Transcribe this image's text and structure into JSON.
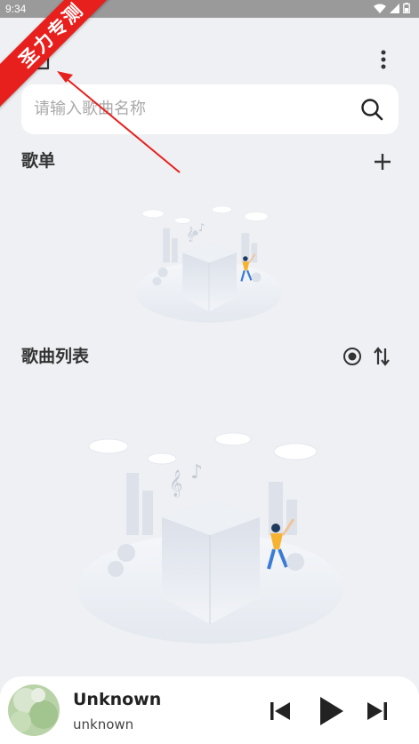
{
  "status_bar": {
    "time": "9:34"
  },
  "watermark": {
    "text": "圣力专测"
  },
  "search": {
    "placeholder": "请输入歌曲名称"
  },
  "sections": {
    "playlist_title": "歌单",
    "songs_title": "歌曲列表"
  },
  "player": {
    "title": "Unknown",
    "artist": "unknown"
  },
  "colors": {
    "background": "#eef0f3",
    "watermark": "#e8201d",
    "card": "#ffffff"
  },
  "icons": [
    "home-icon",
    "more-vertical-icon",
    "search-icon",
    "add-icon",
    "locate-icon",
    "sort-icon",
    "previous-icon",
    "play-icon",
    "next-icon"
  ]
}
